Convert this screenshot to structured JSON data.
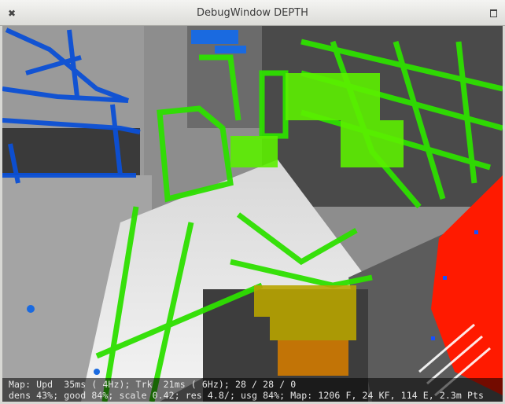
{
  "window": {
    "title": "DebugWindow DEPTH",
    "close_glyph": "✖",
    "close_icon": "close-icon",
    "maximize_icon": "maximize-icon"
  },
  "status": {
    "line1": "Map: Upd  35ms ( 4Hz); Trk  21ms ( 6Hz); 28 / 28 / 0",
    "line2": "dens 43%; good 84%; scale 0.42; res 4.8/; usg 84%; Map: 1206 F, 24 KF, 114 E, 2.3m Pts"
  },
  "colors": {
    "near": "#ff1a00",
    "mid": "#22ee00",
    "far": "#0a4fd8",
    "titlebar": "#e6e6e3",
    "status_text": "#e8e8e8"
  }
}
